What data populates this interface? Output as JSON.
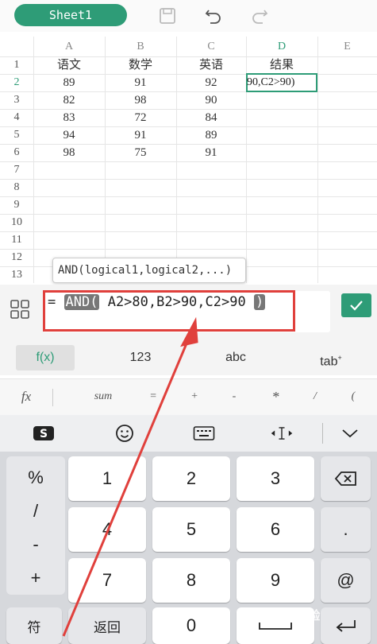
{
  "toolbar": {
    "sheet_tab": "Sheet1"
  },
  "columns": [
    "A",
    "B",
    "C",
    "D",
    "E"
  ],
  "rows": [
    "1",
    "2",
    "3",
    "4",
    "5",
    "6",
    "7",
    "8",
    "9",
    "10",
    "11",
    "12",
    "13"
  ],
  "cells": [
    [
      "语文",
      "数学",
      "英语",
      "结果"
    ],
    [
      "89",
      "91",
      "92"
    ],
    [
      "82",
      "98",
      "90"
    ],
    [
      "83",
      "72",
      "84"
    ],
    [
      "94",
      "91",
      "89"
    ],
    [
      "98",
      "75",
      "91"
    ]
  ],
  "active_cell_text": "90,C2>90)",
  "tooltip": "AND(logical1,logical2,...)",
  "formula": {
    "prefix": "=",
    "func": "AND(",
    "args": "A2>80,B2>90,C2>90",
    "close": ")"
  },
  "function_tabs": [
    "f(x)",
    "123",
    "abc",
    "tab"
  ],
  "operators": [
    "fx",
    "sum",
    "=",
    "+",
    "-",
    "*",
    "/",
    "("
  ],
  "keyboard": {
    "left_column": [
      "%",
      "/",
      "-",
      "+"
    ],
    "digits": [
      "1",
      "2",
      "3",
      "4",
      "5",
      "6",
      "7",
      "8",
      "9",
      "0"
    ],
    "dot": ".",
    "at": "@",
    "symbol_key": "符",
    "back_key": "返回"
  },
  "watermark": "Bai经验",
  "colors": {
    "accent": "#2e9c77",
    "annotation": "#e0403c"
  }
}
